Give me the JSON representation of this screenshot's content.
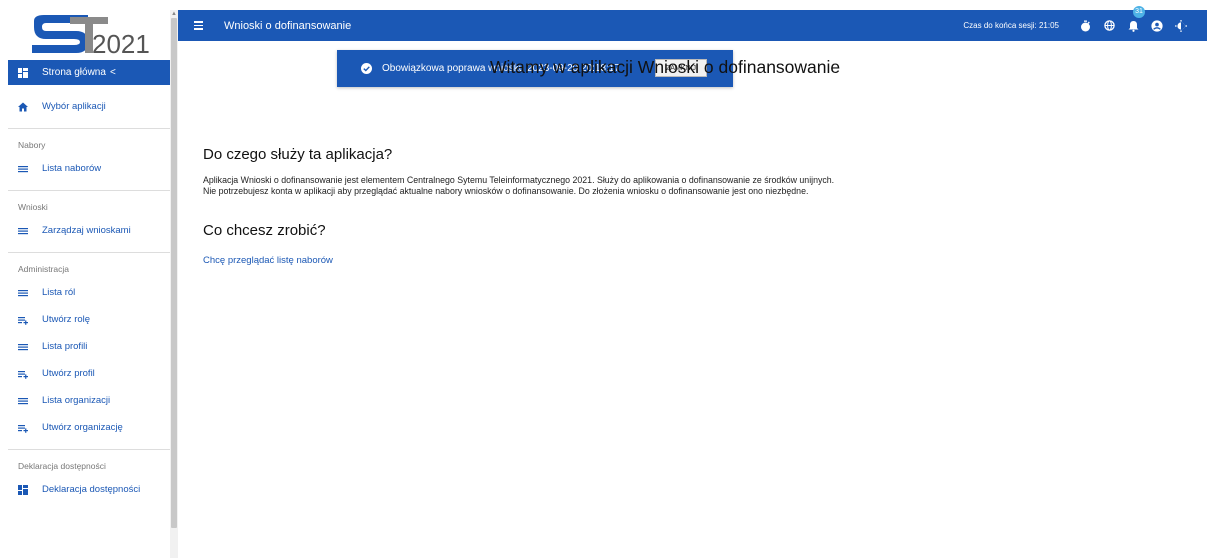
{
  "logo": {
    "text": "2021"
  },
  "sidebar": {
    "home_label": "Strona główna",
    "home_chevron": "<",
    "items_top": [
      {
        "label": "Wybór aplikacji",
        "icon": "home-icon"
      }
    ],
    "sections": [
      {
        "title": "Nabory",
        "items": [
          {
            "label": "Lista naborów",
            "icon": "list-icon"
          }
        ]
      },
      {
        "title": "Wnioski",
        "items": [
          {
            "label": "Zarządzaj wnioskami",
            "icon": "list-icon"
          }
        ]
      },
      {
        "title": "Administracja",
        "items": [
          {
            "label": "Lista ról",
            "icon": "list-icon"
          },
          {
            "label": "Utwórz rolę",
            "icon": "playlist-add-icon"
          },
          {
            "label": "Lista profili",
            "icon": "list-icon"
          },
          {
            "label": "Utwórz profil",
            "icon": "playlist-add-icon"
          },
          {
            "label": "Lista organizacji",
            "icon": "list-icon"
          },
          {
            "label": "Utwórz organizację",
            "icon": "playlist-add-icon"
          }
        ]
      },
      {
        "title": "Deklaracja dostępności",
        "items": [
          {
            "label": "Deklaracja dostępności",
            "icon": "dashboard-icon"
          }
        ]
      }
    ]
  },
  "topbar": {
    "title": "Wnioski o dofinansowanie",
    "session_label": "Czas do końca sesji: 21:05",
    "notification_count": "31"
  },
  "toast": {
    "message": "Obowiązkowa poprawa wniosku 2023-09-20 20:18:17",
    "close_label": "ZAMKNIJ"
  },
  "main": {
    "welcome": "Witamy w aplikacji Wnioski o dofinansowanie",
    "about_heading": "Do czego służy ta aplikacja?",
    "about_line1": "Aplikacja Wnioski o dofinansowanie jest elementem Centralnego Sytemu Teleinformatycznego 2021. Służy do aplikowania o dofinansowanie ze środków unijnych.",
    "about_line2": "Nie potrzebujesz konta w aplikacji aby przeglądać aktualne nabory wniosków o dofinansowanie. Do złożenia wniosku o dofinansowanie jest ono niezbędne.",
    "todo_heading": "Co chcesz zrobić?",
    "browse_link": "Chcę przeglądać listę naborów"
  },
  "colors": {
    "primary": "#1b58b5",
    "badge": "#4db2e6"
  }
}
